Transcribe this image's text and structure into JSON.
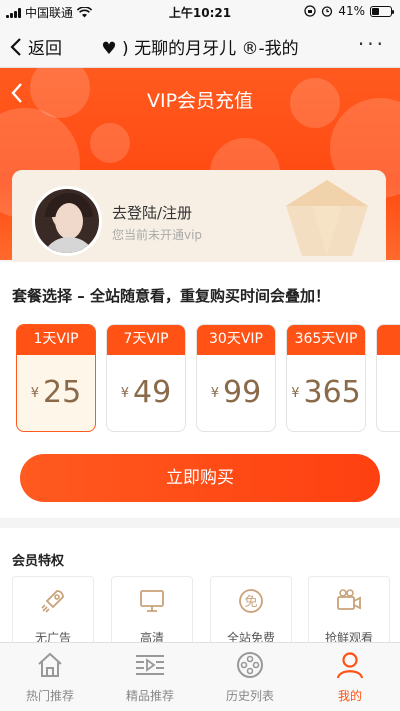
{
  "status_bar": {
    "carrier": "中国联通",
    "time": "上午10:21",
    "battery": "41%",
    "battery_level": 0.41
  },
  "nav": {
    "back_label": "返回",
    "title": "♥ ) 无聊的月牙儿 ®-我的",
    "more": "···"
  },
  "hero": {
    "title": "VIP会员充值"
  },
  "user": {
    "login_label": "去登陆/注册",
    "status_text": "您当前未开通vip"
  },
  "packages": {
    "heading": "套餐选择 – 全站随意看，重复购买时间会叠加！",
    "currency": "¥",
    "items": [
      {
        "tag": "1天VIP",
        "price": "25",
        "selected": true
      },
      {
        "tag": "7天VIP",
        "price": "49"
      },
      {
        "tag": "30天VIP",
        "price": "99"
      },
      {
        "tag": "365天VIP",
        "price": "365"
      }
    ],
    "buy_label": "立即购买"
  },
  "privileges": {
    "heading": "会员特权",
    "items": [
      {
        "label": "无广告",
        "icon": "rocket-icon"
      },
      {
        "label": "高清",
        "icon": "monitor-icon"
      },
      {
        "label": "全站免费",
        "icon": "free-badge-icon"
      },
      {
        "label": "抢鲜观看",
        "icon": "video-camera-icon"
      }
    ]
  },
  "tabs": [
    {
      "label": "热门推荐",
      "icon": "home-icon"
    },
    {
      "label": "精品推荐",
      "icon": "film-list-icon"
    },
    {
      "label": "历史列表",
      "icon": "film-reel-icon"
    },
    {
      "label": "我的",
      "icon": "user-icon",
      "active": true
    }
  ],
  "colors": {
    "accent": "#ff5214",
    "price": "#8a6a49",
    "card": "#f7efe4"
  }
}
